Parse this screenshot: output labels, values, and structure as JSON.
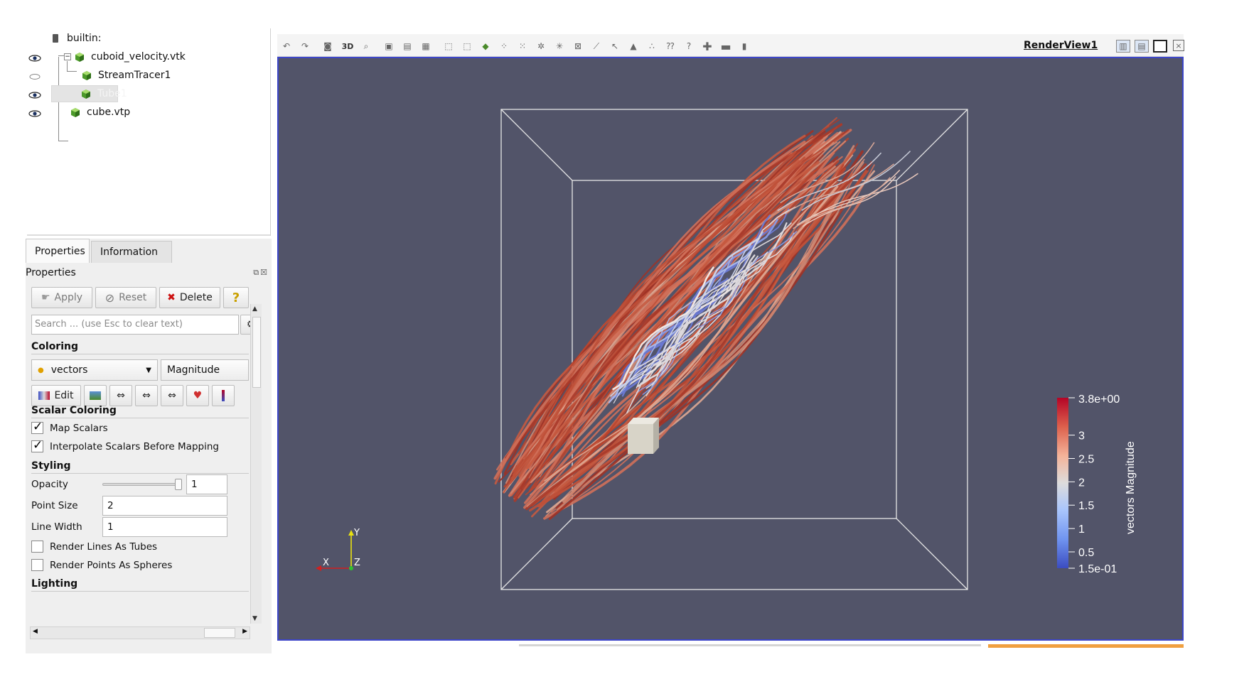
{
  "pipeline": {
    "items": [
      {
        "label": "builtin:",
        "visible": null
      },
      {
        "label": "cuboid_velocity.vtk",
        "visible": true
      },
      {
        "label": "StreamTracer1",
        "visible": false
      },
      {
        "label": "Tube1",
        "visible": true
      },
      {
        "label": "cube.vtp",
        "visible": true
      }
    ]
  },
  "props_panel": {
    "tabs": [
      "Properties",
      "Information"
    ],
    "title": "Properties",
    "buttons": {
      "apply": "Apply",
      "reset": "Reset",
      "delete": "Delete",
      "help": "?"
    },
    "search_placeholder": "Search ... (use Esc to clear text)",
    "coloring": {
      "section": "Coloring",
      "array": "vectors",
      "component": "Magnitude",
      "edit": "Edit"
    },
    "scalar_coloring": {
      "section": "Scalar Coloring",
      "map_scalars": "Map Scalars",
      "interpolate": "Interpolate Scalars Before Mapping"
    },
    "styling": {
      "section": "Styling",
      "opacity_label": "Opacity",
      "opacity_value": "1",
      "opacity_fraction": 1.0,
      "point_size_label": "Point Size",
      "point_size_value": "2",
      "line_width_label": "Line Width",
      "line_width_value": "1",
      "render_lines_tubes": "Render Lines As Tubes",
      "render_points_spheres": "Render Points As Spheres"
    },
    "lighting": {
      "section": "Lighting"
    }
  },
  "render_view": {
    "toolbar_3d": "3D",
    "name": "RenderView1",
    "background": "#525469",
    "axes": {
      "x": "X",
      "y": "Y",
      "z": "Z"
    },
    "colorbar": {
      "title": "vectors Magnitude",
      "max_label": "3.8e+00",
      "min_label": "1.5e-01",
      "ticks": [
        "3",
        "2.5",
        "2",
        "1.5",
        "1",
        "0.5"
      ],
      "colors": [
        "#b40426",
        "#dd604c",
        "#f4b399",
        "#dddcdc",
        "#a9c5fc",
        "#7094f0",
        "#3b4cc0"
      ]
    }
  }
}
